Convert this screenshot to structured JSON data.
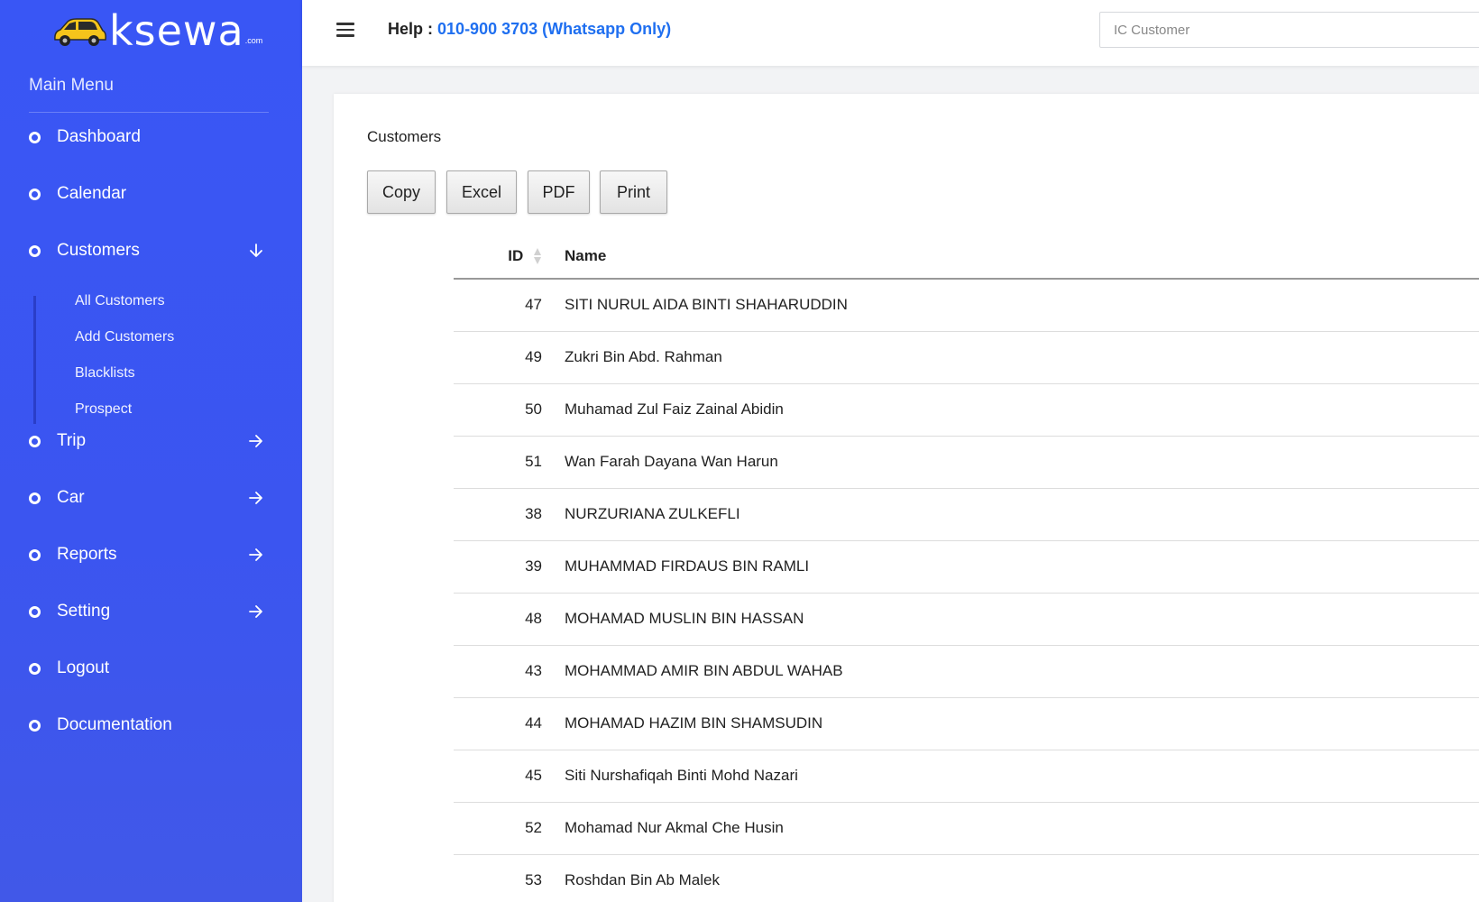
{
  "brand": {
    "name": "ksewa",
    "suffix": ".com"
  },
  "sidebar": {
    "menu_title": "Main Menu",
    "items": [
      {
        "label": "Dashboard",
        "arrow": "none"
      },
      {
        "label": "Calendar",
        "arrow": "none"
      },
      {
        "label": "Customers",
        "arrow": "down"
      },
      {
        "label": "Trip",
        "arrow": "right"
      },
      {
        "label": "Car",
        "arrow": "right"
      },
      {
        "label": "Reports",
        "arrow": "right"
      },
      {
        "label": "Setting",
        "arrow": "right"
      },
      {
        "label": "Logout",
        "arrow": "none"
      },
      {
        "label": "Documentation",
        "arrow": "none"
      }
    ],
    "customers_submenu": [
      "All Customers",
      "Add Customers",
      "Blacklists",
      "Prospect"
    ]
  },
  "header": {
    "help_label": "Help :",
    "help_phone": "010-900 3703 (Whatsapp Only)",
    "search_placeholder": "IC Customer"
  },
  "main": {
    "title": "Customers",
    "buttons": [
      "Copy",
      "Excel",
      "PDF",
      "Print"
    ],
    "table": {
      "columns": [
        "ID",
        "Name"
      ],
      "rows": [
        {
          "id": "47",
          "name": "SITI NURUL AIDA BINTI SHAHARUDDIN"
        },
        {
          "id": "49",
          "name": "Zukri Bin Abd. Rahman"
        },
        {
          "id": "50",
          "name": "Muhamad Zul Faiz Zainal Abidin"
        },
        {
          "id": "51",
          "name": "Wan Farah Dayana Wan Harun"
        },
        {
          "id": "38",
          "name": "NURZURIANA ZULKEFLI"
        },
        {
          "id": "39",
          "name": "MUHAMMAD FIRDAUS BIN RAMLI"
        },
        {
          "id": "48",
          "name": "MOHAMAD MUSLIN BIN HASSAN"
        },
        {
          "id": "43",
          "name": "MOHAMMAD AMIR BIN ABDUL WAHAB"
        },
        {
          "id": "44",
          "name": "MOHAMAD HAZIM BIN SHAMSUDIN"
        },
        {
          "id": "45",
          "name": "Siti Nurshafiqah Binti Mohd Nazari"
        },
        {
          "id": "52",
          "name": "Mohamad Nur Akmal Che Husin"
        },
        {
          "id": "53",
          "name": "Roshdan Bin Ab Malek"
        }
      ]
    }
  },
  "colors": {
    "sidebar": "#3956f5",
    "link": "#1f6ff0",
    "brand_car": "#f5c41b"
  }
}
